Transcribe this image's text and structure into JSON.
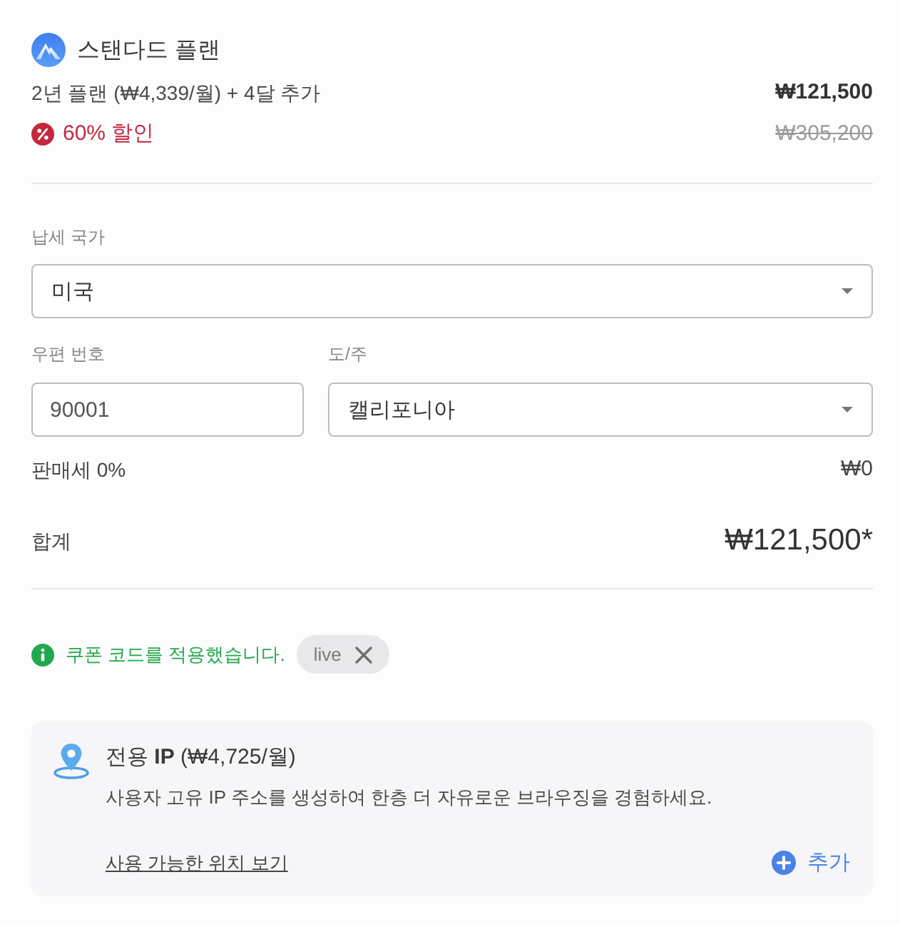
{
  "plan": {
    "name": "스탠다드 플랜",
    "description": "2년 플랜 (₩4,339/월) + 4달 추가",
    "price": "₩121,500",
    "discount": "60% 할인",
    "original_price": "₩305,200"
  },
  "tax_form": {
    "rows": [
      {
        "fields": [
          {
            "kind": "select",
            "label": "납세 국가",
            "value": "미국"
          }
        ]
      },
      {
        "fields": [
          {
            "kind": "text",
            "label": "우편 번호",
            "value": "90001"
          },
          {
            "kind": "select",
            "label": "도/주",
            "value": "캘리포니아"
          }
        ]
      }
    ]
  },
  "sales_tax": {
    "label": "판매세 0%",
    "amount": "₩0"
  },
  "total": {
    "label": "합계",
    "amount": "₩121,500*"
  },
  "coupon": {
    "message": "쿠폰 코드를 적용했습니다.",
    "code": "live"
  },
  "addon": {
    "title": "전용 **IP** (₩4,725/월)",
    "description": "사용자 고유 IP 주소를 생성하여 한층 더 자유로운 브라우징을 경험하세요.",
    "link": "사용 가능한 위치 보기",
    "button": "추가"
  }
}
